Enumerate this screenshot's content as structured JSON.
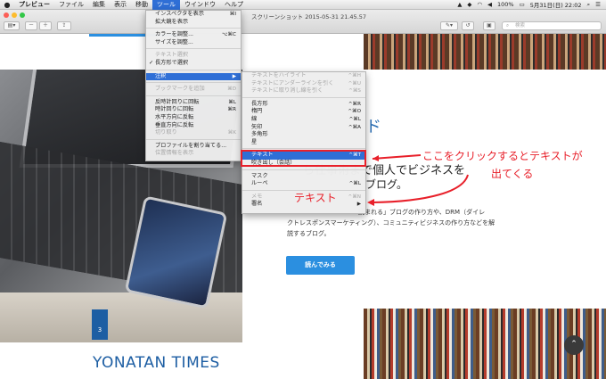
{
  "menubar": {
    "apple": "",
    "items": [
      {
        "label": "プレビュー"
      },
      {
        "label": "ファイル"
      },
      {
        "label": "編集"
      },
      {
        "label": "表示"
      },
      {
        "label": "移動"
      },
      {
        "label": "ツール"
      },
      {
        "label": "ウインドウ"
      },
      {
        "label": "ヘルプ"
      }
    ],
    "status": {
      "battery": "100%",
      "date_time": "5月31日(日)  22:02"
    }
  },
  "window": {
    "title": "スクリーンショット 2015-05-31 21.45.57",
    "search_placeholder": "検索"
  },
  "tool_menu": [
    {
      "label": "インスペクタを表示",
      "shortcut": "⌘I",
      "state": "normal"
    },
    {
      "label": "拡大鏡を表示",
      "shortcut": "",
      "state": "normal"
    },
    {
      "sep": true
    },
    {
      "label": "カラーを調整...",
      "shortcut": "⌥⌘C",
      "state": "normal"
    },
    {
      "label": "サイズを調整...",
      "shortcut": "",
      "state": "normal"
    },
    {
      "sep": true
    },
    {
      "label": "テキスト選択",
      "shortcut": "",
      "state": "disabled"
    },
    {
      "label": "長方形で選択",
      "shortcut": "",
      "state": "normal",
      "checked": true
    },
    {
      "sep": true
    },
    {
      "label": "注釈",
      "shortcut": "▶",
      "state": "selected"
    },
    {
      "sep": true
    },
    {
      "label": "ブックマークを追加",
      "shortcut": "⌘D",
      "state": "disabled"
    },
    {
      "sep": true
    },
    {
      "label": "反時計回りに回転",
      "shortcut": "⌘L",
      "state": "normal"
    },
    {
      "label": "時計回りに回転",
      "shortcut": "⌘R",
      "state": "normal"
    },
    {
      "label": "水平方向に反転",
      "shortcut": "",
      "state": "normal"
    },
    {
      "label": "垂直方向に反転",
      "shortcut": "",
      "state": "normal"
    },
    {
      "label": "切り取り",
      "shortcut": "⌘K",
      "state": "disabled"
    },
    {
      "sep": true
    },
    {
      "label": "プロファイルを割り当てる...",
      "shortcut": "",
      "state": "normal"
    },
    {
      "label": "位置情報を表示",
      "shortcut": "",
      "state": "disabled"
    }
  ],
  "annot_menu": [
    {
      "label": "テキストをハイライト",
      "shortcut": "^⌘H",
      "state": "disabled"
    },
    {
      "label": "テキストにアンダーラインを引く",
      "shortcut": "^⌘U",
      "state": "disabled"
    },
    {
      "label": "テキストに取り消し線を引く",
      "shortcut": "^⌘S",
      "state": "disabled"
    },
    {
      "sep": true
    },
    {
      "label": "長方形",
      "shortcut": "^⌘R",
      "state": "normal"
    },
    {
      "label": "楕円",
      "shortcut": "^⌘O",
      "state": "normal"
    },
    {
      "label": "線",
      "shortcut": "^⌘L",
      "state": "normal"
    },
    {
      "label": "矢印",
      "shortcut": "^⌘A",
      "state": "normal"
    },
    {
      "label": "多角形",
      "shortcut": "",
      "state": "normal"
    },
    {
      "label": "星",
      "shortcut": "",
      "state": "normal"
    },
    {
      "sep": true
    },
    {
      "label": "テキスト",
      "shortcut": "^⌘T",
      "state": "selected"
    },
    {
      "label": "吹き出し（会話）",
      "shortcut": "",
      "state": "normal"
    },
    {
      "sep": true
    },
    {
      "label": "マスク",
      "shortcut": "",
      "state": "normal"
    },
    {
      "label": "ルーペ",
      "shortcut": "^⌘L",
      "state": "normal"
    },
    {
      "sep": true
    },
    {
      "label": "メモ",
      "shortcut": "^⌘N",
      "state": "disabled"
    },
    {
      "label": "署名",
      "shortcut": "▶",
      "state": "normal"
    }
  ],
  "document": {
    "heading_k": "ド",
    "heading_line1": "ら仕事術まで個人でビジネスを",
    "heading_line2": "ブログ。",
    "body_line1": "読まれる」ブログの作り方や、DRM（ダイレ",
    "body_line2": "クトレスポンスマーケティング）、コミュニティビジネスの作り方などを解",
    "body_line3": "説するブログ。",
    "read_button": "読んでみる",
    "badge_number": "3",
    "site_title": "YONATAN TIMES"
  },
  "annotations": {
    "callout_line1": "ここをクリックするとテキストが",
    "callout_line2": "出てくる",
    "label_text": "テキスト",
    "color": "#e8202a"
  }
}
